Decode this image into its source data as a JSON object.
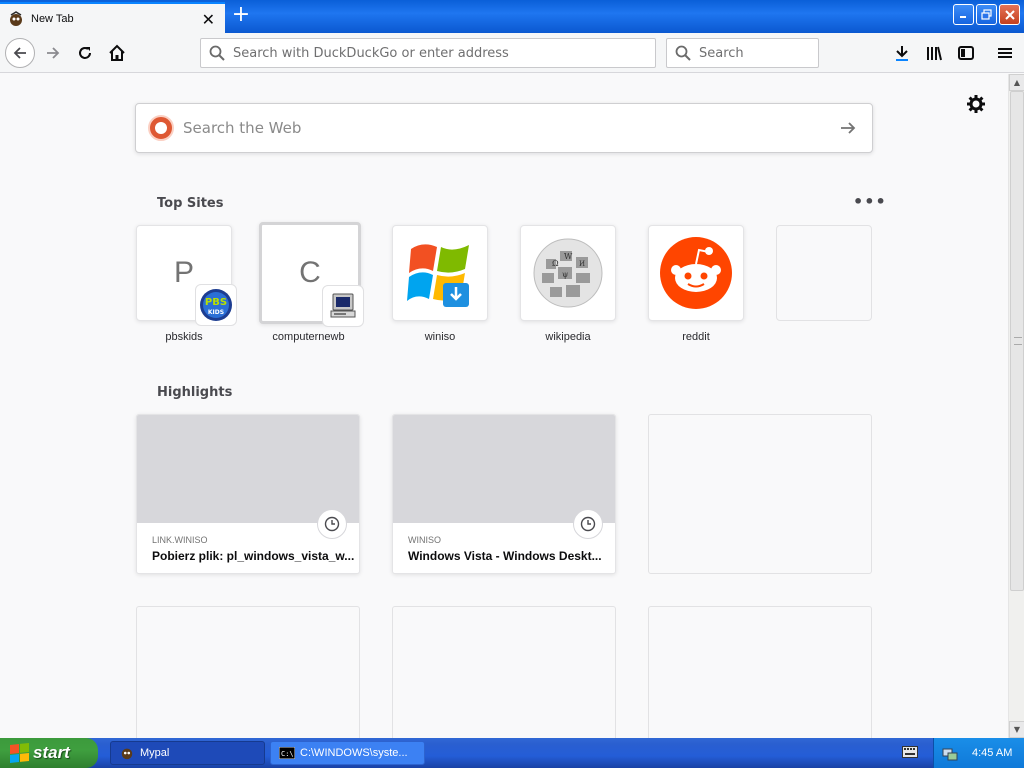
{
  "browser": {
    "tab_title": "New Tab",
    "url_placeholder": "Search with DuckDuckGo or enter address",
    "search_placeholder": "Search"
  },
  "newtab": {
    "websearch_placeholder": "Search the Web",
    "top_sites_title": "Top Sites",
    "highlights_title": "Highlights",
    "top_sites": [
      {
        "label": "pbskids",
        "letter": "P",
        "badge": "PBS KIDS"
      },
      {
        "label": "computernewb",
        "letter": "C",
        "badge": "computer-icon"
      },
      {
        "label": "winiso",
        "icon": "windows-logo-icon"
      },
      {
        "label": "wikipedia",
        "icon": "wikipedia-globe-icon"
      },
      {
        "label": "reddit",
        "icon": "reddit-alien-icon"
      }
    ],
    "highlights": [
      {
        "source": "LINK.WINISO",
        "title": "Pobierz plik: pl_windows_vista_w..."
      },
      {
        "source": "WINISO",
        "title": "Windows Vista - Windows Deskt..."
      }
    ]
  },
  "taskbar": {
    "start_label": "start",
    "tasks": [
      {
        "label": "Mypal",
        "active": true
      },
      {
        "label": "C:\\WINDOWS\\syste...",
        "active": false
      }
    ],
    "clock": "4:45 AM"
  },
  "colors": {
    "accent": "#0a84ff",
    "reddit": "#ff4500",
    "ddg": "#de5833",
    "taskbar": "#245dd7",
    "start": "#3c9a3c"
  }
}
